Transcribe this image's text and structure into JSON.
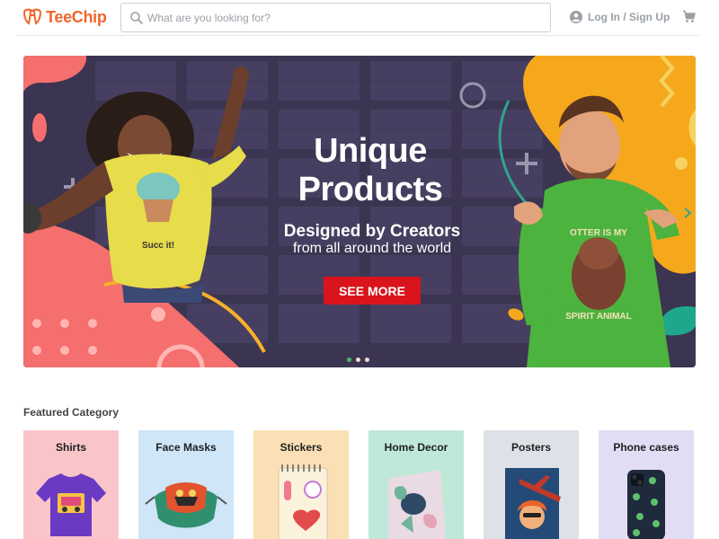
{
  "brand": {
    "name": "TeeChip",
    "accent": "#f0662a"
  },
  "search": {
    "placeholder": "What are you looking for?",
    "value": ""
  },
  "nav": {
    "login_label": "Log In / Sign Up",
    "account_icon": "account-circle-icon",
    "cart_icon": "cart-icon"
  },
  "hero": {
    "title_line1": "Unique",
    "title_line2": "Products",
    "subtitle_line1": "Designed by Creators",
    "subtitle_line2": "from all around the world",
    "cta_label": "SEE MORE",
    "cta_color": "#d9141c",
    "slide_count": 3,
    "active_slide": 1,
    "shirt_left_text": "Succ it!",
    "shirt_right_text_1": "OTTER IS MY",
    "shirt_right_text_2": "SPIRIT ANIMAL"
  },
  "featured": {
    "title": "Featured Category",
    "categories": [
      {
        "label": "Shirts",
        "bg": "#f9c5c9"
      },
      {
        "label": "Face Masks",
        "bg": "#cfe5f8"
      },
      {
        "label": "Stickers",
        "bg": "#fbe0b6"
      },
      {
        "label": "Home Decor",
        "bg": "#bfe8d8"
      },
      {
        "label": "Posters",
        "bg": "#dde2e8"
      },
      {
        "label": "Phone cases",
        "bg": "#e2dcf5"
      }
    ]
  }
}
